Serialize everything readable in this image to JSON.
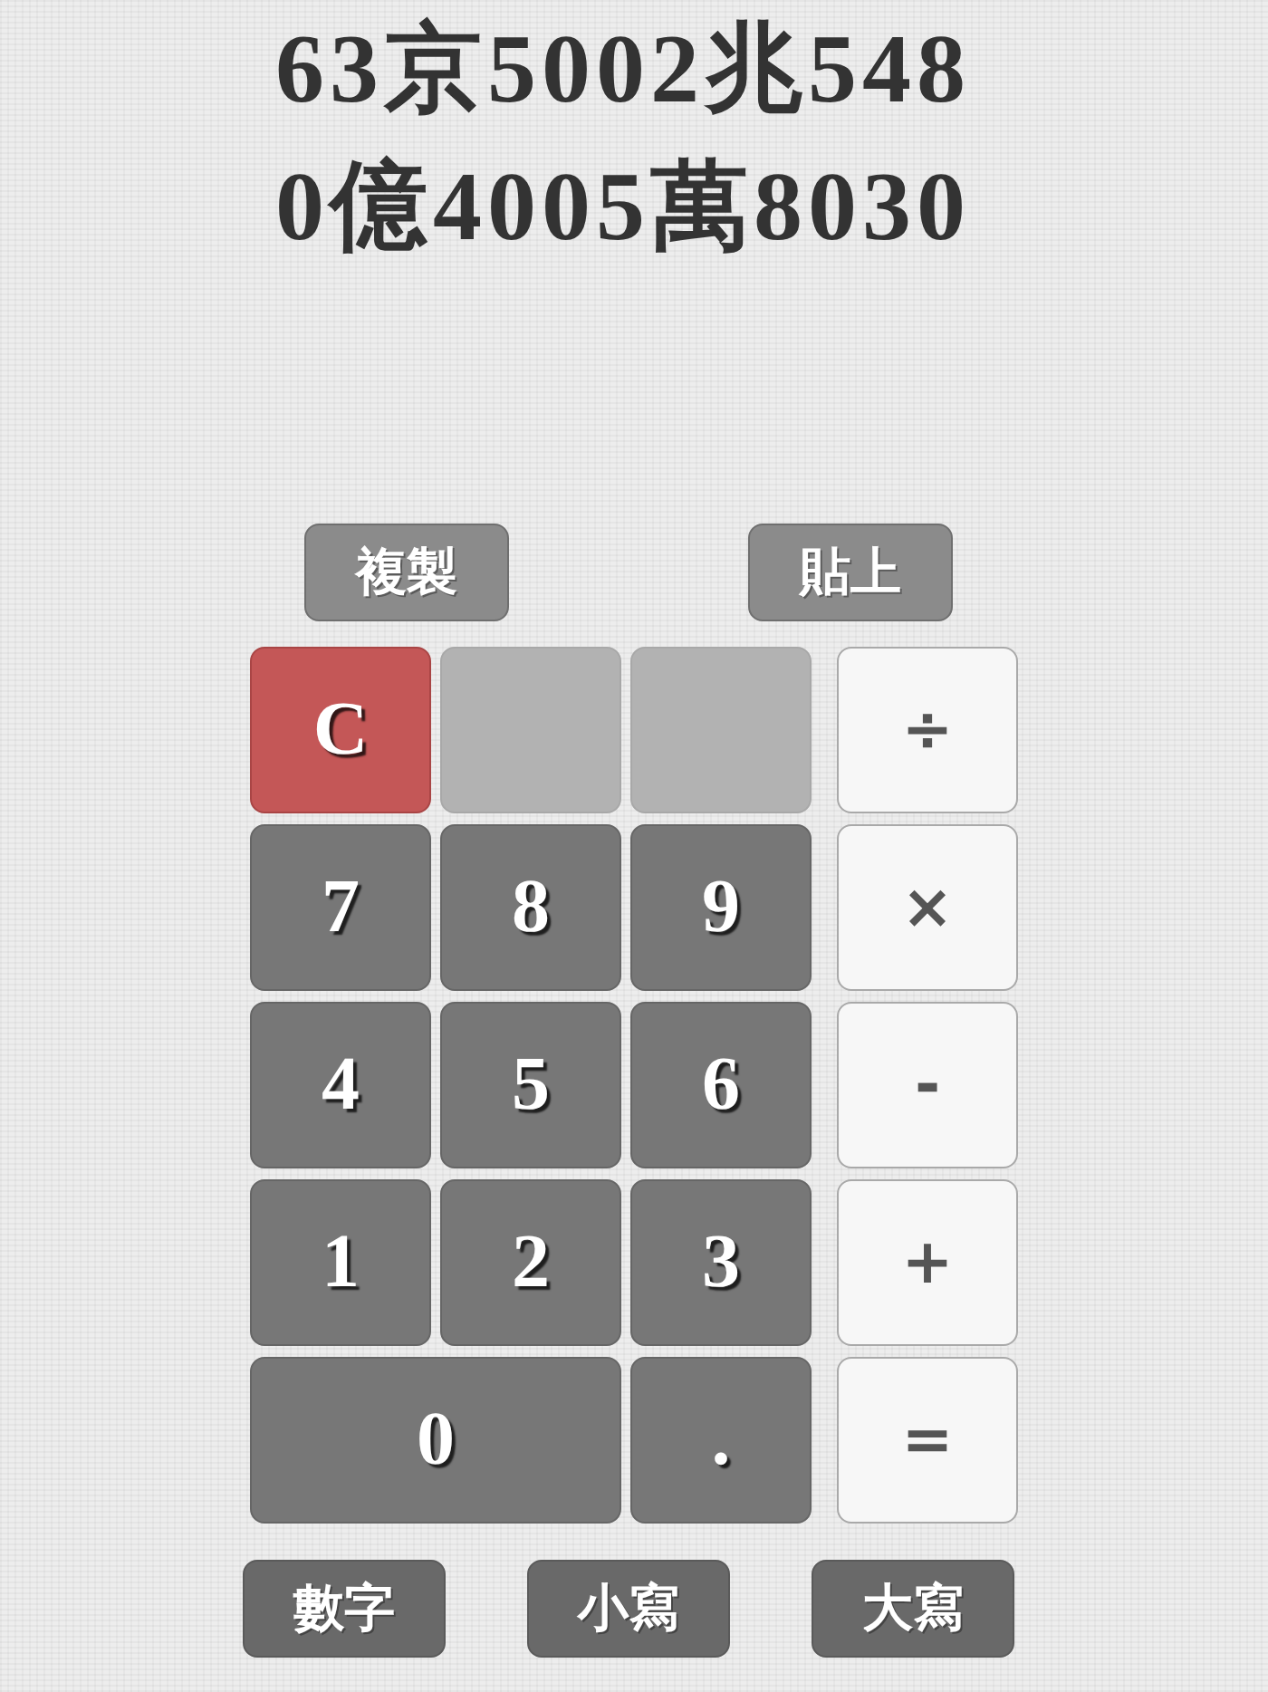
{
  "display": {
    "lines": [
      "63京5002兆548",
      "0億4005萬8030"
    ]
  },
  "clipboard_buttons": [
    {
      "label": "複製"
    },
    {
      "label": "貼上"
    }
  ],
  "keypad": {
    "keys": [
      {
        "kind": "clear",
        "label": "C"
      },
      {
        "kind": "blank"
      },
      {
        "kind": "blank"
      },
      {
        "kind": "digit",
        "label": "7"
      },
      {
        "kind": "digit",
        "label": "8"
      },
      {
        "kind": "digit",
        "label": "9"
      },
      {
        "kind": "digit",
        "label": "4"
      },
      {
        "kind": "digit",
        "label": "5"
      },
      {
        "kind": "digit",
        "label": "6"
      },
      {
        "kind": "digit",
        "label": "1"
      },
      {
        "kind": "digit",
        "label": "2"
      },
      {
        "kind": "digit",
        "label": "3"
      },
      {
        "kind": "wide",
        "label": "0"
      },
      {
        "kind": "digit",
        "label": "."
      }
    ],
    "operators": [
      "÷",
      "×",
      "-",
      "+",
      "="
    ]
  },
  "mode_buttons": [
    {
      "label": "數字"
    },
    {
      "label": "小寫"
    },
    {
      "label": "大寫"
    }
  ]
}
